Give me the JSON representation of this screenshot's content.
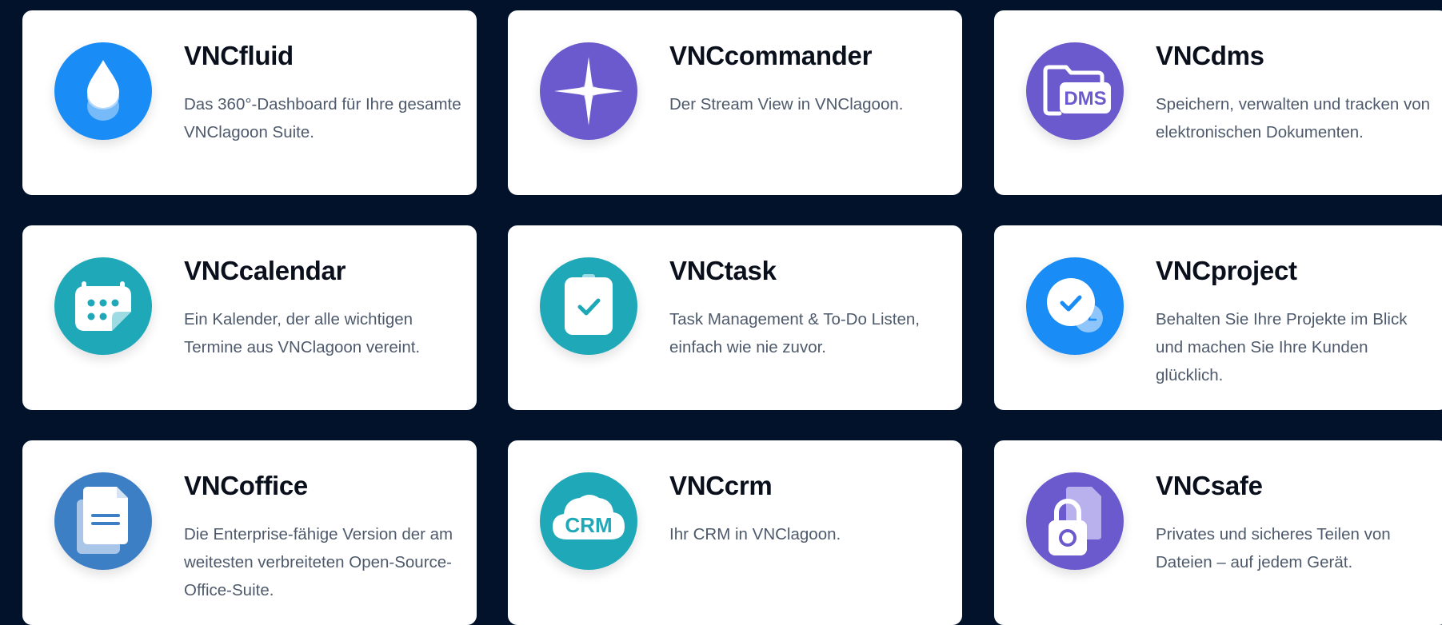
{
  "colors": {
    "background": "#03122b",
    "card": "#ffffff",
    "blue": "#1a8cf5",
    "purple": "#6b5acd",
    "teal": "#1fa8b8",
    "steel_blue": "#3d7fc4"
  },
  "apps": [
    {
      "title": "VNCfluid",
      "description": "Das 360°-Dashboard für Ihre gesamte VNClagoon Suite.",
      "icon": "water-drop-icon",
      "color": "#1a8cf5"
    },
    {
      "title": "VNCcommander",
      "description": "Der Stream View in VNClagoon.",
      "icon": "compass-star-icon",
      "color": "#6b5acd"
    },
    {
      "title": "VNCdms",
      "description": "Speichern, verwalten und tracken von elektronischen Dokumenten.",
      "icon": "dms-folder-icon",
      "color": "#6b5acd",
      "icon_text": "DMS"
    },
    {
      "title": "VNCcalendar",
      "description": "Ein Kalender, der alle wichtigen Termine aus VNClagoon vereint.",
      "icon": "calendar-icon",
      "color": "#1fa8b8"
    },
    {
      "title": "VNCtask",
      "description": "Task Management & To-Do Listen, einfach wie nie zuvor.",
      "icon": "clipboard-check-icon",
      "color": "#1fa8b8"
    },
    {
      "title": "VNCproject",
      "description": "Behalten Sie Ihre Projekte im Blick und machen Sie Ihre Kunden glücklich.",
      "icon": "check-clock-icon",
      "color": "#1a8cf5"
    },
    {
      "title": "VNCoffice",
      "description": "Die Enterprise-fähige Version der am weitesten verbreiteten Open-Source-Office-Suite.",
      "icon": "document-icon",
      "color": "#3d7fc4"
    },
    {
      "title": "VNCcrm",
      "description": "Ihr CRM in VNClagoon.",
      "icon": "crm-cloud-icon",
      "color": "#1fa8b8",
      "icon_text": "CRM"
    },
    {
      "title": "VNCsafe",
      "description": "Privates und sicheres Teilen von Dateien – auf jedem Gerät.",
      "icon": "padlock-file-icon",
      "color": "#6b5acd"
    }
  ]
}
